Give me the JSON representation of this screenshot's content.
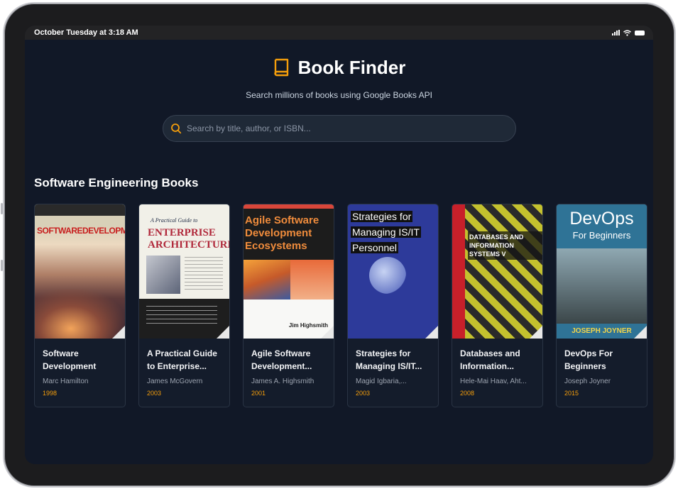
{
  "status_bar": {
    "datetime": "October Tuesday at 3:18 AM"
  },
  "header": {
    "title": "Book Finder",
    "subtitle": "Search millions of books using Google Books API",
    "icon": "book-icon",
    "accent_color": "#f59e0b"
  },
  "search": {
    "placeholder": "Search by title, author, or ISBN...",
    "value": ""
  },
  "section": {
    "title": "Software Engineering Books"
  },
  "books": [
    {
      "title": "Software Development",
      "author": "Marc Hamilton",
      "year": "1998",
      "cover": {
        "line1": "SOFTWAREDEVELOPMENT"
      }
    },
    {
      "title": "A Practical Guide to Enterprise...",
      "author": "James McGovern",
      "year": "2003",
      "cover": {
        "line1": "A Practical Guide to",
        "line2": "ENTERPRISE ARCHITECTURE"
      }
    },
    {
      "title": "Agile Software Development...",
      "author": "James A. Highsmith",
      "year": "2001",
      "cover": {
        "line1": "Agile Software Development Ecosystems",
        "line2": "Jim Highsmith"
      }
    },
    {
      "title": "Strategies for Managing IS/IT...",
      "author": "Magid Igbaria,...",
      "year": "2003",
      "cover": {
        "line1": "Strategies for",
        "line2": "Managing IS/IT",
        "line3": "Personnel"
      }
    },
    {
      "title": "Databases and Information...",
      "author": "Hele-Mai Haav, Aht...",
      "year": "2008",
      "cover": {
        "line1": "DATABASES AND INFORMATION SYSTEMS V"
      }
    },
    {
      "title": "DevOps For Beginners",
      "author": "Joseph Joyner",
      "year": "2015",
      "cover": {
        "line1": "DevOps",
        "line2": "For Beginners",
        "line3": "JOSEPH JOYNER"
      }
    }
  ]
}
